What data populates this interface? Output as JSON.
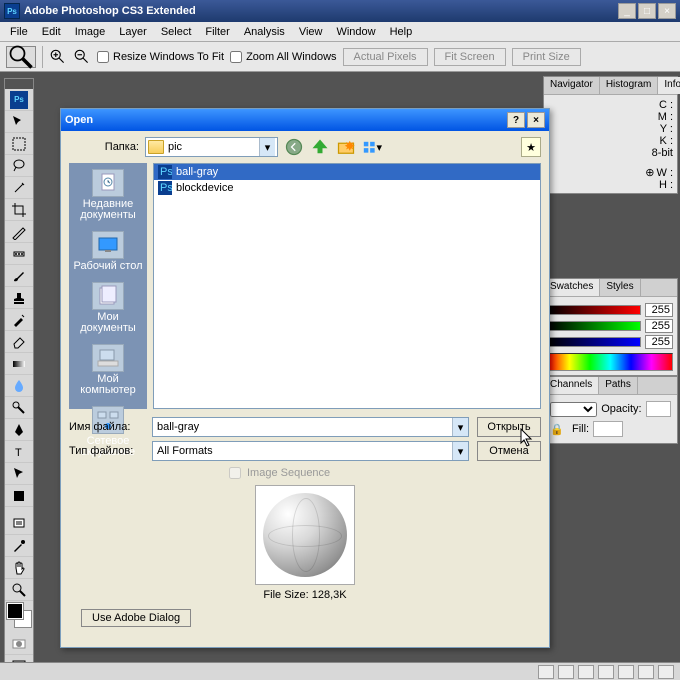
{
  "title": "Adobe Photoshop CS3 Extended",
  "menu": [
    "File",
    "Edit",
    "Image",
    "Layer",
    "Select",
    "Filter",
    "Analysis",
    "View",
    "Window",
    "Help"
  ],
  "options": {
    "resize_label": "Resize Windows To Fit",
    "zoom_all_label": "Zoom All Windows",
    "actual_pixels": "Actual Pixels",
    "fit_screen": "Fit Screen",
    "print_size": "Print Size"
  },
  "panels": {
    "nav_tabs": [
      "Navigator",
      "Histogram",
      "Info"
    ],
    "info": {
      "rows": [
        "C :",
        "M :",
        "Y :",
        "K :",
        "8-bit"
      ],
      "wh": [
        "W :",
        "H :"
      ]
    },
    "swatch_tabs": [
      "Swatches",
      "Styles"
    ],
    "slider_vals": [
      "255",
      "255",
      "255"
    ],
    "layer_tabs": [
      "Channels",
      "Paths"
    ],
    "opacity_label": "Opacity:",
    "fill_label": "Fill:"
  },
  "dialog": {
    "title": "Open",
    "folder_label": "Папка:",
    "folder_value": "pic",
    "places": [
      {
        "label": "Недавние\nдокументы"
      },
      {
        "label": "Рабочий стол"
      },
      {
        "label": "Мои\nдокументы"
      },
      {
        "label": "Мой\nкомпьютер"
      },
      {
        "label": "Сетевое\nокружение"
      }
    ],
    "files": [
      {
        "name": "ball-gray",
        "selected": true,
        "type": "ps"
      },
      {
        "name": "blockdevice",
        "selected": false,
        "type": "ps"
      }
    ],
    "filename_label": "Имя файла:",
    "filename_value": "ball-gray",
    "filetype_label": "Тип файлов:",
    "filetype_value": "All Formats",
    "open_btn": "Открыть",
    "cancel_btn": "Отмена",
    "img_seq_label": "Image Sequence",
    "filesize_label": "File Size: 128,3K",
    "adobe_dlg_btn": "Use Adobe Dialog"
  }
}
